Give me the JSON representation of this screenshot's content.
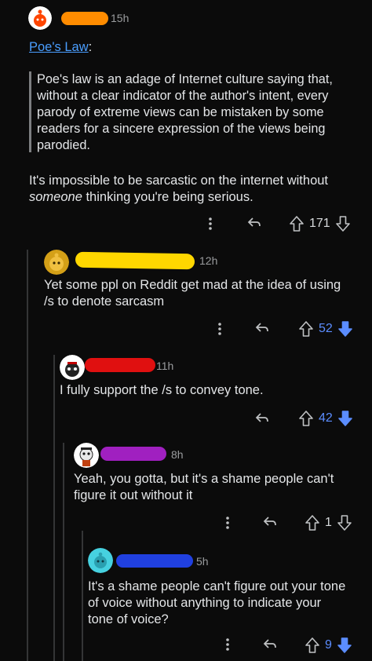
{
  "comments": [
    {
      "time": "15h",
      "link": "Poe's Law",
      "colon": ":",
      "quote": "Poe's law is an adage of Internet culture saying that, without a clear indicator of the author's intent, every parody of extreme views can be mistaken by some readers for a sincere expression of the views being parodied.",
      "body_pre": "It's impossible to be sarcastic on the internet without ",
      "body_em": "someone",
      "body_post": " thinking you're being serious.",
      "votes": "171",
      "upvoted": false
    },
    {
      "time": "12h",
      "body": "Yet some ppl on Reddit get mad at the idea of using /s to denote sarcasm",
      "votes": "52",
      "upvoted": true
    },
    {
      "time": "11h",
      "body": "I fully support the /s to convey tone.",
      "votes": "42",
      "upvoted": true
    },
    {
      "time": "8h",
      "body": "Yeah, you gotta,  but it's a shame people can't figure it out without it",
      "votes": "1",
      "upvoted": false
    },
    {
      "time": "5h",
      "body": "It's a shame people can't figure out your tone of voice without anything to indicate your tone of voice?",
      "votes": "9",
      "upvoted": true
    }
  ],
  "colors": {
    "redact_c1": "#ff8c00",
    "redact_c2": "#ffd700",
    "redact_c3": "#e01010",
    "redact_c4": "#a020c0",
    "redact_c5": "#2040e0",
    "upvote_blue": "#5b8dff"
  },
  "icons": [
    "more-icon",
    "reply-icon",
    "upvote-icon",
    "downvote-icon"
  ]
}
